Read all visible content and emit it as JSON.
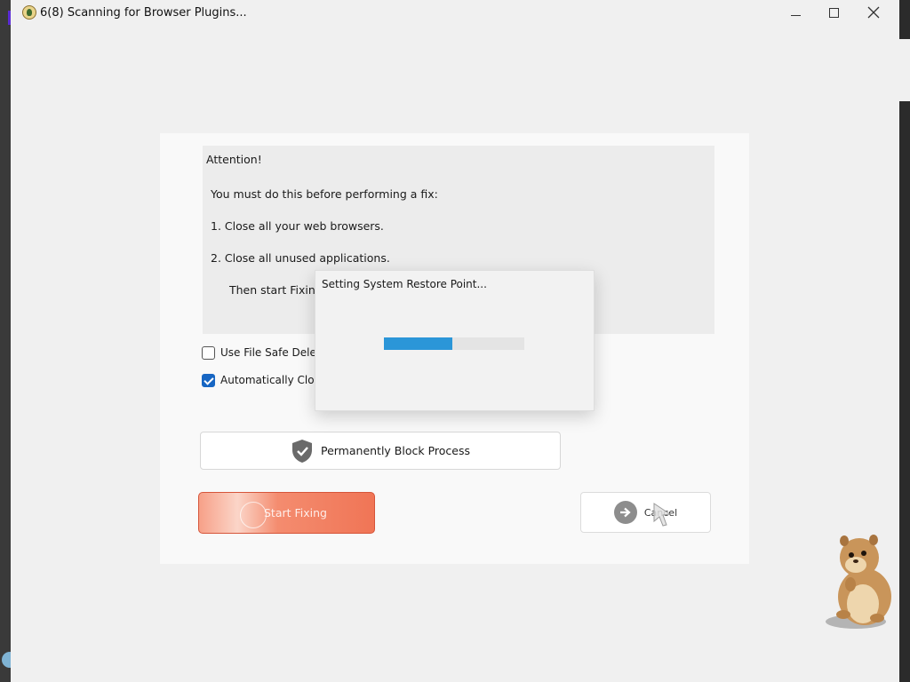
{
  "window": {
    "title": "6(8) Scanning for Browser Plugins...",
    "controls": [
      "minimize",
      "maximize",
      "close"
    ]
  },
  "attention": {
    "heading": "Attention!",
    "intro": "You must do this before performing a fix:",
    "step1": "1. Close all your web browsers.",
    "step2": "2. Close all unused applications.",
    "then": "Then start Fixing"
  },
  "options": {
    "file_safe": {
      "label": "Use File Safe Deleti",
      "checked": false
    },
    "auto_close": {
      "label": "Automatically Close",
      "checked": true
    }
  },
  "buttons": {
    "block": "Permanently Block Process",
    "start": "Start Fixing",
    "cancel": "Cancel"
  },
  "dialog": {
    "message": "Setting System Restore Point...",
    "progress": 0.49
  },
  "colors": {
    "accent": "#1766c3",
    "progress": "#2b96d8",
    "start_button": "#f07556"
  },
  "icons": [
    "app-icon",
    "shield-check-icon",
    "arrow-right-icon",
    "cursor-icon",
    "mascot-hamster"
  ]
}
